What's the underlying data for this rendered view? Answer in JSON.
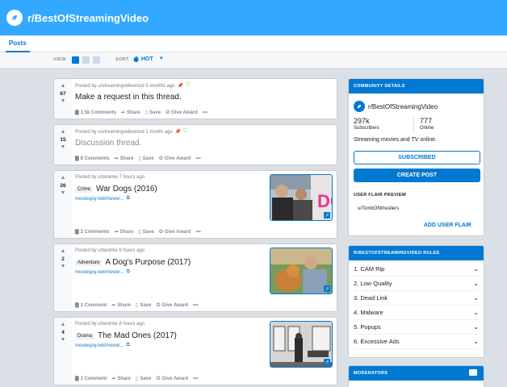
{
  "header": {
    "title": "r/BestOfStreamingVideo"
  },
  "nav": {
    "tab": "Posts"
  },
  "sortbar": {
    "view_label": "VIEW",
    "sort_label": "SORT",
    "sort_value": "HOT"
  },
  "posts": [
    {
      "score": "67",
      "meta": "Posted by u/streamingvideomod 5 months ago",
      "title": "Make a request in this thread.",
      "comments": "1.5k Comments",
      "share": "Share",
      "save": "Save",
      "award": "Give Award",
      "more": "•••"
    },
    {
      "score": "15",
      "meta": "Posted by u/streamingvideomod 1 month ago",
      "title": "Discussion thread.",
      "comments": "8 Comments",
      "share": "Share",
      "save": "Save",
      "award": "Give Award",
      "more": "•••"
    },
    {
      "score": "26",
      "meta": "Posted by u/taninke 7 hours ago",
      "flair": "Crime",
      "title": "War Dogs (2016)",
      "link": "moviesjoy.net/movie/...",
      "comments": "2 Comments",
      "share": "Share",
      "save": "Save",
      "award": "Give Award",
      "more": "•••"
    },
    {
      "score": "2",
      "meta": "Posted by u/taninke 6 hours ago",
      "flair": "Adventure",
      "title": "A Dog's Purpose (2017)",
      "link": "moviesjoy.net/movie/...",
      "comments": "1 Comment",
      "share": "Share",
      "save": "Save",
      "award": "Give Award",
      "more": "•••"
    },
    {
      "score": "4",
      "meta": "Posted by u/taninke 8 hours ago",
      "flair": "Drama",
      "title": "The Mad Ones (2017)",
      "link": "moviesjoy.net/movie/...",
      "comments": "1 Comment",
      "share": "Share",
      "save": "Save",
      "award": "Give Award",
      "more": "•••"
    }
  ],
  "community": {
    "heading": "COMMUNITY DETAILS",
    "name": "r/BestOfStreamingVideo",
    "subscribers": "297k",
    "subscribers_label": "Subscribers",
    "online": "777",
    "online_label": "Online",
    "description": "Streaming movies and TV online.",
    "subscribed_btn": "SUBSCRIBED",
    "create_btn": "CREATE POST",
    "flair_heading": "USER FLAIR PREVIEW",
    "flair_user": "u/TombOfWrestlers",
    "add_flair": "ADD USER FLAIR"
  },
  "rules": {
    "heading": "R/BESTOFSTREAMINGVIDEO RULES",
    "items": [
      "1. CAM Rip",
      "2. Low Quality",
      "3. Dead Link",
      "4. Malware",
      "5. Popups",
      "6. Excessive Ads"
    ]
  },
  "moderators": {
    "heading": "MODERATORS"
  },
  "colors": {
    "brand": "#33a8ff",
    "accent": "#0079d3",
    "background": "#dae0e6"
  }
}
